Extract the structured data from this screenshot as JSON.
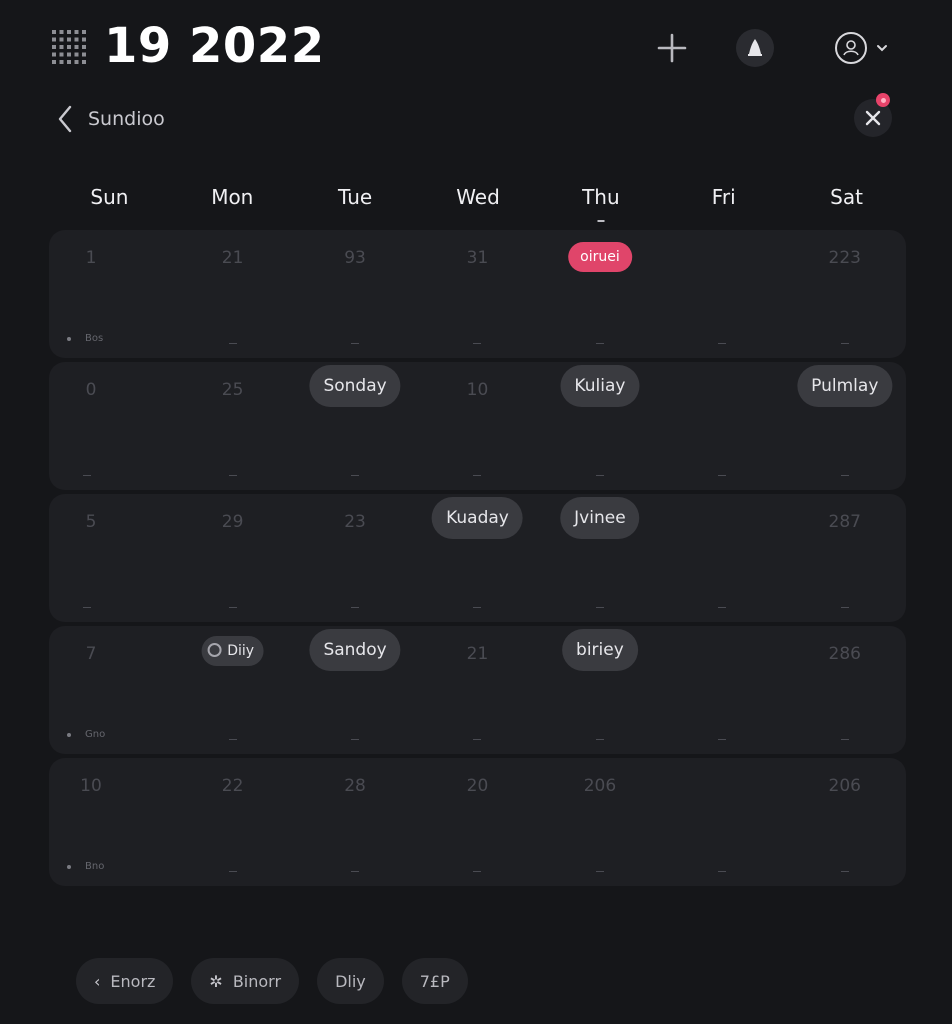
{
  "header": {
    "title": "19 2022",
    "icons": {
      "menu": "grid-icon",
      "add": "plus-icon",
      "notifications": "bell-icon",
      "profile": "avatar-icon",
      "profile_menu": "chevron-down-icon"
    }
  },
  "subheader": {
    "back_label": "Sundioo",
    "filter_badge": true
  },
  "weekdays": [
    "Sun",
    "Mon",
    "Tue",
    "Wed",
    "Thu",
    "Fri",
    "Sat"
  ],
  "weeks": [
    {
      "days": [
        {
          "num": "1"
        },
        {
          "num": "21"
        },
        {
          "num": "93"
        },
        {
          "num": "31"
        },
        {
          "num": "",
          "event": "oiruei",
          "event_style": "highlight"
        },
        {
          "num": ""
        },
        {
          "num": "223"
        }
      ],
      "note": "Bos"
    },
    {
      "days": [
        {
          "num": "0"
        },
        {
          "num": "25"
        },
        {
          "num": "",
          "event": "Sonday"
        },
        {
          "num": "10"
        },
        {
          "num": "",
          "event": "Kuliay"
        },
        {
          "num": ""
        },
        {
          "num": "",
          "event": "Pulmlay"
        }
      ],
      "note": ""
    },
    {
      "days": [
        {
          "num": "5"
        },
        {
          "num": "29"
        },
        {
          "num": "23"
        },
        {
          "num": "",
          "event": "Kuaday"
        },
        {
          "num": "",
          "event": "Jvinee"
        },
        {
          "num": ""
        },
        {
          "num": "287"
        }
      ],
      "note": ""
    },
    {
      "days": [
        {
          "num": "7"
        },
        {
          "num": "",
          "event": "Diiy",
          "event_style": "small"
        },
        {
          "num": "",
          "event": "Sandoy"
        },
        {
          "num": "21"
        },
        {
          "num": "",
          "event": "biriey"
        },
        {
          "num": ""
        },
        {
          "num": "286"
        }
      ],
      "note": "Gno"
    },
    {
      "days": [
        {
          "num": "10"
        },
        {
          "num": "22"
        },
        {
          "num": "28"
        },
        {
          "num": "20"
        },
        {
          "num": "206"
        },
        {
          "num": ""
        },
        {
          "num": "206"
        }
      ],
      "note": "Bno"
    }
  ],
  "toolbar": {
    "chips": [
      {
        "label": "Enorz",
        "icon": "‹",
        "icon_name": "chevron-left-icon"
      },
      {
        "label": "Binorr",
        "icon": "✲",
        "icon_name": "asterisk-icon"
      },
      {
        "label": "Dliy",
        "icon": "",
        "icon_name": ""
      },
      {
        "label": "7£P",
        "icon": "",
        "icon_name": ""
      }
    ]
  },
  "colors": {
    "background": "#151619",
    "row": "#1e1f23",
    "event": "#3a3b40",
    "accent": "#e0456a"
  }
}
